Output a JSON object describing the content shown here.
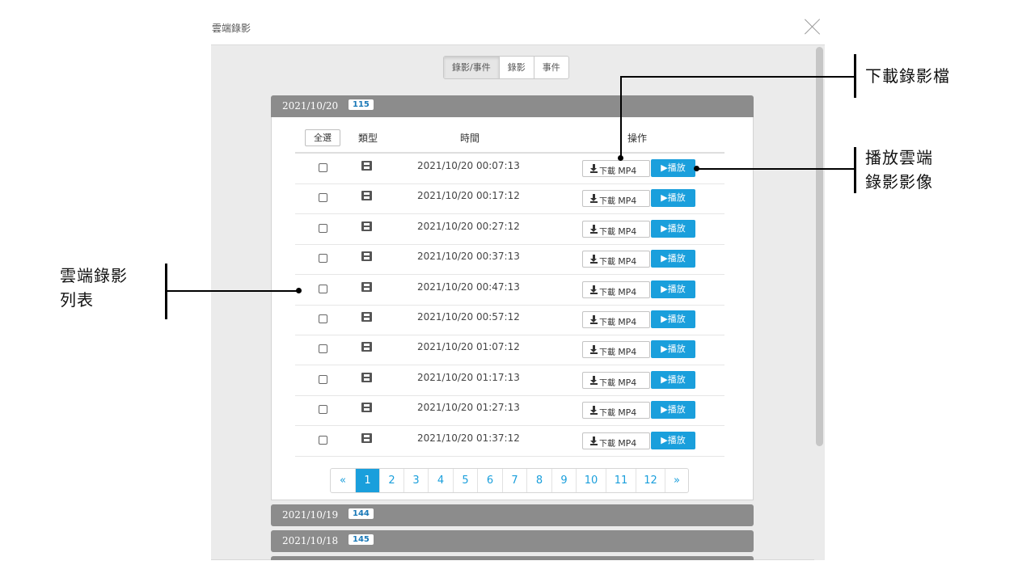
{
  "dialog": {
    "title": "雲端錄影"
  },
  "filter_tabs": [
    {
      "label": "錄影/事件",
      "active": true
    },
    {
      "label": "錄影",
      "active": false
    },
    {
      "label": "事件",
      "active": false
    }
  ],
  "groups": [
    {
      "date": "2021/10/20",
      "count": "115",
      "expanded": true
    },
    {
      "date": "2021/10/19",
      "count": "144",
      "expanded": false
    },
    {
      "date": "2021/10/18",
      "count": "145",
      "expanded": false
    }
  ],
  "table": {
    "select_all": "全選",
    "col_type": "類型",
    "col_time": "時間",
    "col_action": "操作",
    "rows": [
      {
        "time": "2021/10/20 00:07:13"
      },
      {
        "time": "2021/10/20 00:17:12"
      },
      {
        "time": "2021/10/20 00:27:12"
      },
      {
        "time": "2021/10/20 00:37:13"
      },
      {
        "time": "2021/10/20 00:47:13"
      },
      {
        "time": "2021/10/20 00:57:12"
      },
      {
        "time": "2021/10/20 01:07:12"
      },
      {
        "time": "2021/10/20 01:17:13"
      },
      {
        "time": "2021/10/20 01:27:13"
      },
      {
        "time": "2021/10/20 01:37:12"
      }
    ],
    "download_label": "下載",
    "download_format": "MP4",
    "play_label": "▶播放"
  },
  "pagination": {
    "prev": "«",
    "pages": [
      "1",
      "2",
      "3",
      "4",
      "5",
      "6",
      "7",
      "8",
      "9",
      "10",
      "11",
      "12"
    ],
    "next": "»",
    "current": "1"
  },
  "annotations": {
    "download": "下載錄影檔",
    "play_line1": "播放雲端",
    "play_line2": "錄影影像",
    "list_line1": "雲端錄影",
    "list_line2": "列表"
  },
  "colors": {
    "accent": "#1a9fdc",
    "group_header": "#8c8c8c",
    "panel_bg": "#ebebeb"
  }
}
